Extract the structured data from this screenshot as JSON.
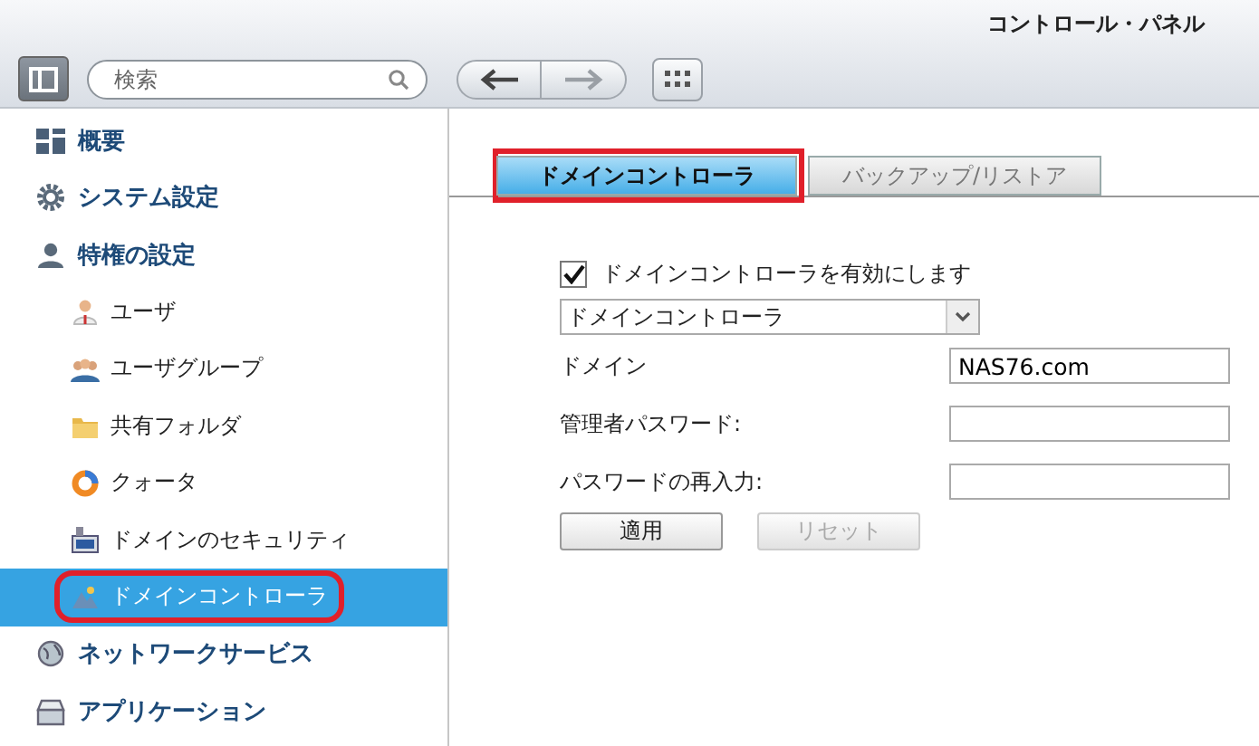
{
  "window": {
    "title": "コントロール・パネル"
  },
  "toolbar": {
    "search": {
      "placeholder": "検索"
    },
    "back_disabled": false,
    "forward_disabled": true
  },
  "sidebar": {
    "items": [
      {
        "label": "概要",
        "selected": false
      },
      {
        "label": "システム設定",
        "selected": false
      },
      {
        "label": "特権の設定",
        "selected": false,
        "children": [
          {
            "label": "ユーザ",
            "selected": false,
            "highlighted": false
          },
          {
            "label": "ユーザグループ",
            "selected": false,
            "highlighted": false
          },
          {
            "label": "共有フォルダ",
            "selected": false,
            "highlighted": false
          },
          {
            "label": "クォータ",
            "selected": false,
            "highlighted": false
          },
          {
            "label": "ドメインのセキュリティ",
            "selected": false,
            "highlighted": false
          },
          {
            "label": "ドメインコントローラ",
            "selected": true,
            "highlighted": true
          }
        ]
      },
      {
        "label": "ネットワークサービス",
        "selected": false
      },
      {
        "label": "アプリケーション",
        "selected": false
      }
    ]
  },
  "tabs": [
    {
      "label": "ドメインコントローラ",
      "selected": true,
      "highlighted": true
    },
    {
      "label": "バックアップ/リストア",
      "selected": false,
      "highlighted": false
    }
  ],
  "form": {
    "enable": {
      "label": "ドメインコントローラを有効にします",
      "checked": true
    },
    "mode_select": {
      "value": "ドメインコントローラ"
    },
    "fields": [
      {
        "label": "ドメイン",
        "value": "NAS76.com"
      },
      {
        "label": "管理者パスワード:"
      },
      {
        "label": "パスワードの再入力:"
      }
    ],
    "buttons": [
      {
        "label": "適用",
        "disabled": false
      },
      {
        "label": "リセット",
        "disabled": true
      }
    ]
  }
}
